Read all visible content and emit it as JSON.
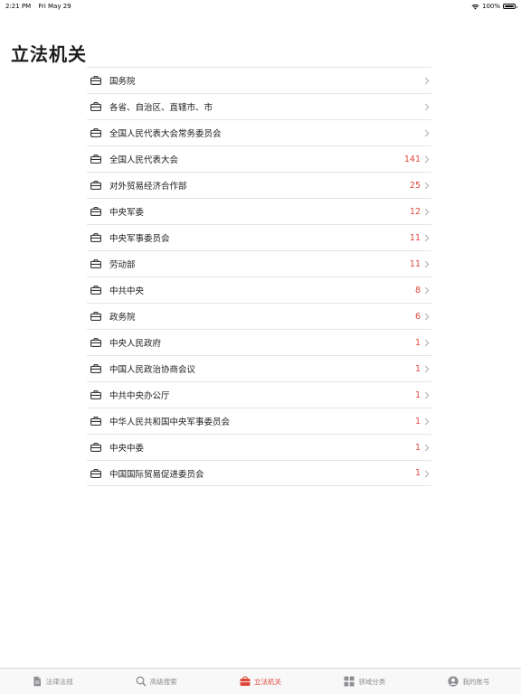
{
  "status_bar": {
    "time": "2:21 PM",
    "date": "Fri May 29",
    "battery": "100%"
  },
  "page": {
    "title": "立法机关"
  },
  "colors": {
    "accent": "#e0473c",
    "separator": "#e5e5ea",
    "secondary_text": "#8e8e93"
  },
  "items": [
    {
      "label": "国务院",
      "count": ""
    },
    {
      "label": "各省、自治区、直辖市、市",
      "count": ""
    },
    {
      "label": "全国人民代表大会常务委员会",
      "count": ""
    },
    {
      "label": "全国人民代表大会",
      "count": "141"
    },
    {
      "label": "对外贸易经济合作部",
      "count": "25"
    },
    {
      "label": "中央军委",
      "count": "12"
    },
    {
      "label": "中央军事委员会",
      "count": "11"
    },
    {
      "label": "劳动部",
      "count": "11"
    },
    {
      "label": "中共中央",
      "count": "8"
    },
    {
      "label": "政务院",
      "count": "6"
    },
    {
      "label": "中央人民政府",
      "count": "1"
    },
    {
      "label": "中国人民政治协商会议",
      "count": "1"
    },
    {
      "label": "中共中央办公厅",
      "count": "1"
    },
    {
      "label": "中华人民共和国中央军事委员会",
      "count": "1"
    },
    {
      "label": "中央中委",
      "count": "1"
    },
    {
      "label": "中国国际贸易促进委员会",
      "count": "1"
    }
  ],
  "item_icon": "briefcase-icon",
  "tabs": [
    {
      "label": "法律法规",
      "icon": "document-icon",
      "active": false
    },
    {
      "label": "高级搜索",
      "icon": "search-icon",
      "active": false
    },
    {
      "label": "立法机关",
      "icon": "briefcase-icon",
      "active": true
    },
    {
      "label": "领域分类",
      "icon": "grid-icon",
      "active": false
    },
    {
      "label": "我的账号",
      "icon": "person-icon",
      "active": false
    }
  ]
}
